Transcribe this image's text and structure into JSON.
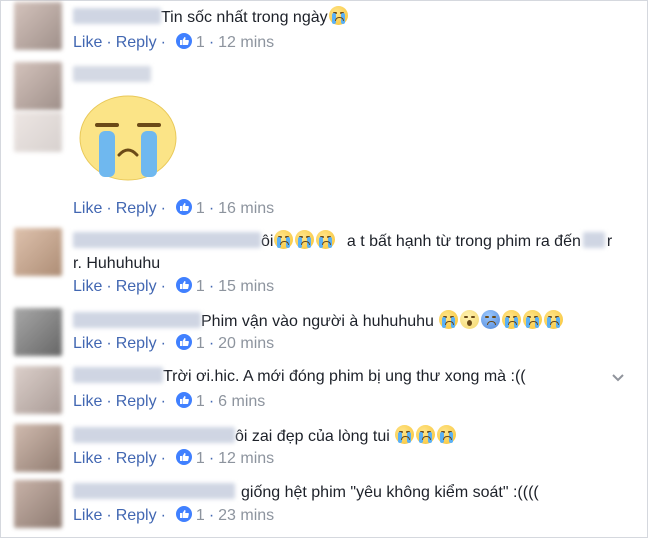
{
  "actions": {
    "like": "Like",
    "reply": "Reply",
    "separator": "·"
  },
  "comments": [
    {
      "text": "Tin sốc nhất trong ngày",
      "reactions": "1",
      "time": "12 mins",
      "emoji": [
        "crying-face"
      ]
    },
    {
      "text": "",
      "sticker": "crying-face-sticker",
      "reactions": "1",
      "time": "16 mins"
    },
    {
      "text": "ôi",
      "text2": "a t bất hạnh từ trong phim ra đến",
      "text3": "r. Huhuhuhu",
      "reactions": "1",
      "time": "15 mins",
      "emoji": [
        "crying-face",
        "crying-face",
        "crying-face"
      ]
    },
    {
      "text": "Phim vận vào người à huhuhuhu",
      "reactions": "1",
      "time": "20 mins",
      "emoji": [
        "crying-face",
        "screaming-face",
        "anxious-face",
        "crying-face",
        "crying-face",
        "crying-face"
      ]
    },
    {
      "text": "Trời ơi.hic. A mới đóng phim bị ung thư xong mà :((",
      "reactions": "1",
      "time": "6 mins"
    },
    {
      "text": "ôi zai đẹp của lòng tui",
      "reactions": "1",
      "time": "12 mins",
      "emoji": [
        "crying-face",
        "crying-face",
        "crying-face"
      ]
    },
    {
      "text": "giống hệt phim \"yêu không kiểm soát\" :((((",
      "reactions": "1",
      "time": "23 mins"
    }
  ]
}
